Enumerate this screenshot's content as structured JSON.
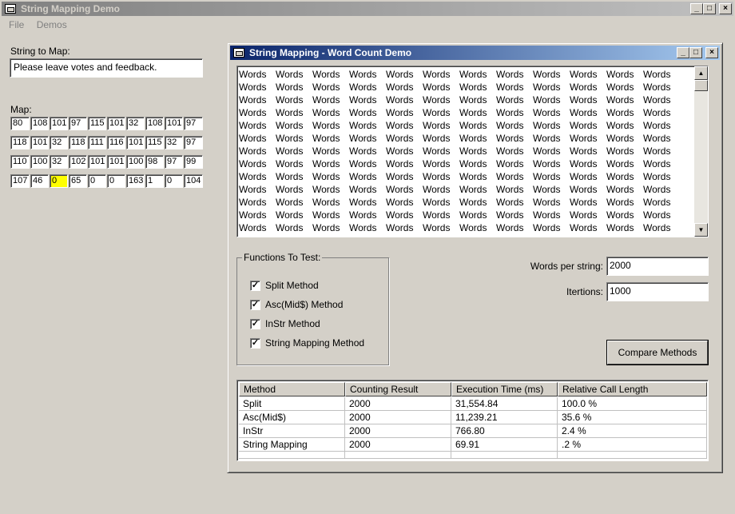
{
  "main_window": {
    "title": "String Mapping Demo",
    "menu": [
      {
        "label": "File"
      },
      {
        "label": "Demos"
      }
    ]
  },
  "string_to_map": {
    "label": "String to Map:",
    "value": "Please leave votes and feedback."
  },
  "map": {
    "label": "Map:",
    "rows": [
      [
        "80",
        "108",
        "101",
        "97",
        "115",
        "101",
        "32",
        "108",
        "101",
        "97"
      ],
      [
        "118",
        "101",
        "32",
        "118",
        "111",
        "116",
        "101",
        "115",
        "32",
        "97"
      ],
      [
        "110",
        "100",
        "32",
        "102",
        "101",
        "101",
        "100",
        "98",
        "97",
        "99"
      ],
      [
        "107",
        "46",
        "0",
        "65",
        "0",
        "0",
        "163",
        "1",
        "0",
        "104"
      ]
    ],
    "highlight_color": "#ffff00"
  },
  "child_window": {
    "title": "String Mapping - Word Count Demo",
    "word": "Words"
  },
  "functions": {
    "title": "Functions To Test:",
    "items": [
      {
        "label": "Split Method",
        "checked": "✓"
      },
      {
        "label": "Asc(Mid$) Method",
        "checked": "✓"
      },
      {
        "label": "InStr Method",
        "checked": "✓"
      },
      {
        "label": "String Mapping Method",
        "checked": "✓"
      }
    ]
  },
  "settings": {
    "words_label": "Words per string:",
    "words_value": "2000",
    "iter_label": "Itertions:",
    "iter_value": "1000"
  },
  "compare_button": "Compare Methods",
  "results": {
    "columns": [
      "Method",
      "Counting Result",
      "Execution Time (ms)",
      "Relative Call Length"
    ],
    "rows": [
      [
        "Split",
        "2000",
        "31,554.84",
        "100.0 %"
      ],
      [
        "Asc(Mid$)",
        "2000",
        "11,239.21",
        "35.6 %"
      ],
      [
        "InStr",
        "2000",
        "766.80",
        "2.4 %"
      ],
      [
        "String Mapping",
        "2000",
        "69.91",
        ".2 %"
      ]
    ]
  }
}
